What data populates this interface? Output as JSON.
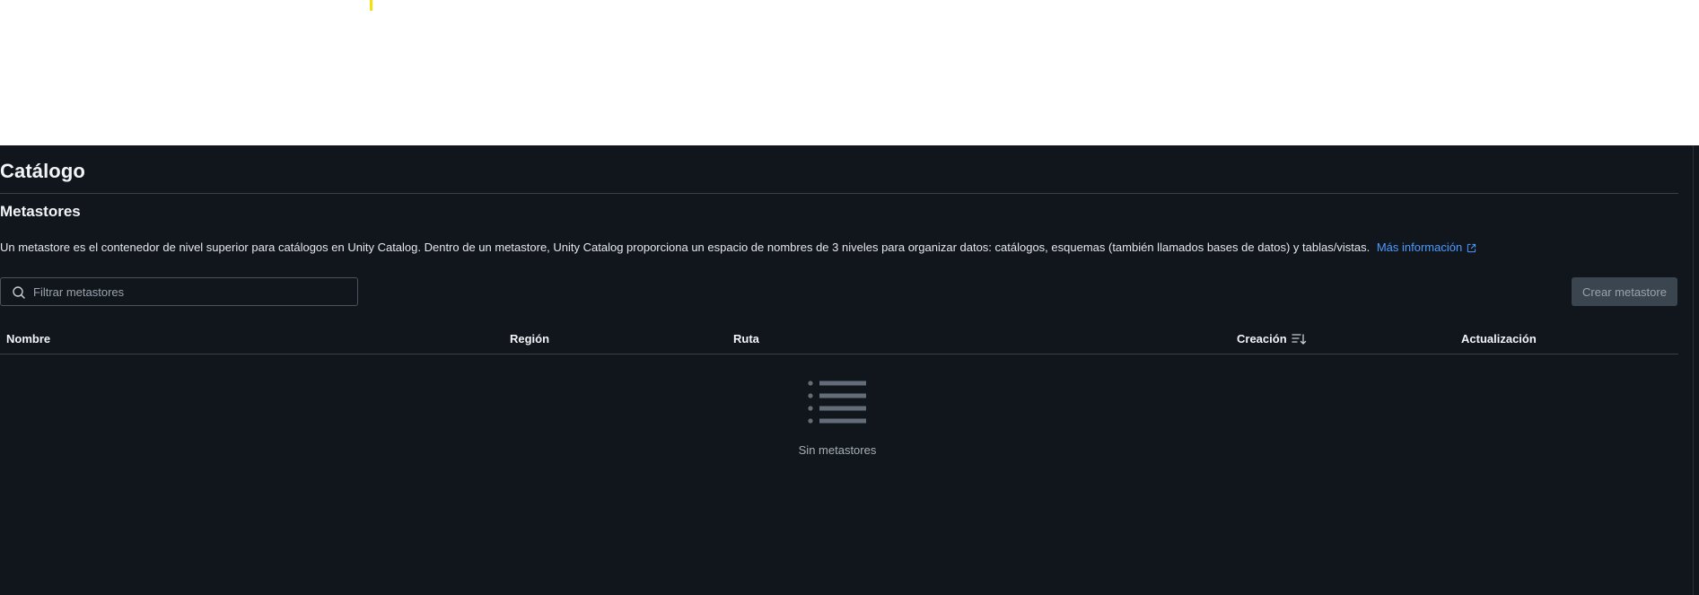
{
  "page": {
    "title": "Catálogo"
  },
  "section": {
    "title": "Metastores",
    "description": "Un metastore es el contenedor de nivel superior para catálogos en Unity Catalog. Dentro de un metastore, Unity Catalog proporciona un espacio de nombres de 3 niveles para organizar datos: catálogos, esquemas (también llamados bases de datos) y tablas/vistas.",
    "learn_more_label": "Más información",
    "link_color": "#4c9aff"
  },
  "search": {
    "placeholder": "Filtrar metastores",
    "value": ""
  },
  "actions": {
    "create_label": "Crear metastore"
  },
  "table": {
    "columns": [
      {
        "label": "Nombre"
      },
      {
        "label": "Región"
      },
      {
        "label": "Ruta"
      },
      {
        "label": "Creación",
        "sorted": true
      },
      {
        "label": "Actualización"
      }
    ],
    "rows": []
  },
  "empty_state": {
    "icon": "list-icon",
    "message": "Sin metastores"
  },
  "colors": {
    "background": "#11161d",
    "text": "#e6e9ee",
    "muted_text": "#a6afb9",
    "disabled_button": "#3b4550"
  }
}
